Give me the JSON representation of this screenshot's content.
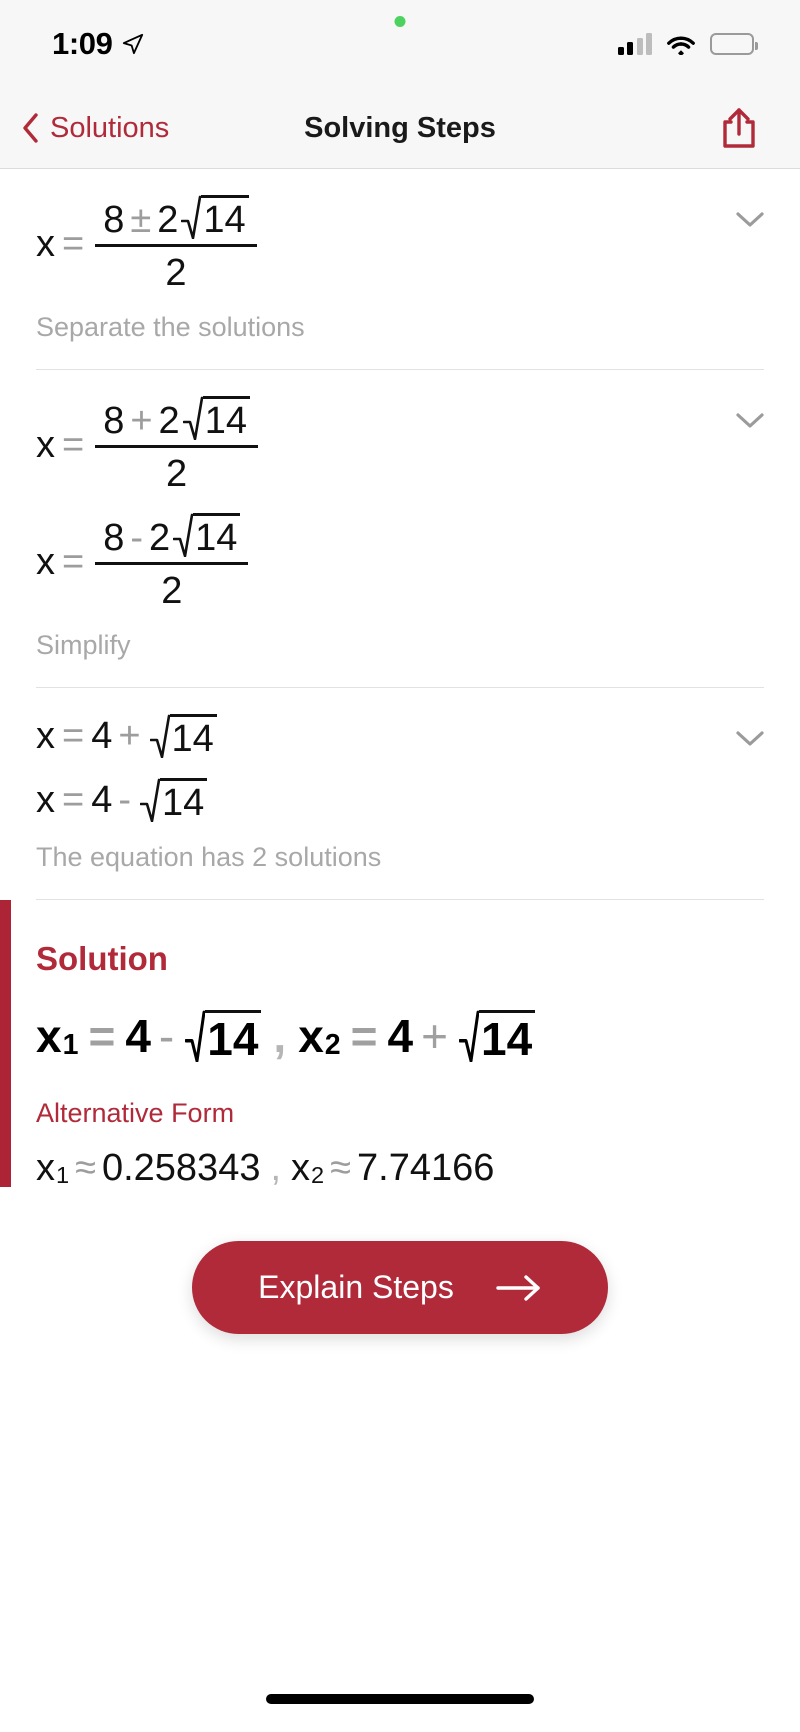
{
  "statusbar": {
    "time": "1:09",
    "location_icon": "location-arrow-icon",
    "signal_icon": "cellular-signal-icon",
    "wifi_icon": "wifi-icon",
    "battery_icon": "battery-icon",
    "recording_dot": "green-status-dot"
  },
  "navbar": {
    "back_label": "Solutions",
    "back_icon": "chevron-left-icon",
    "title": "Solving Steps",
    "share_icon": "share-icon"
  },
  "steps": [
    {
      "caption": "Separate the solutions",
      "chevron_icon": "chevron-down-icon",
      "lines": [
        {
          "lhs": "x",
          "eq": "=",
          "type": "fraction",
          "num": {
            "a": "8",
            "op": "±",
            "coef": "2",
            "radicand": "14"
          },
          "den": "2"
        }
      ]
    },
    {
      "caption": "Simplify",
      "chevron_icon": "chevron-down-icon",
      "lines": [
        {
          "lhs": "x",
          "eq": "=",
          "type": "fraction",
          "num": {
            "a": "8",
            "op": "+",
            "coef": "2",
            "radicand": "14"
          },
          "den": "2"
        },
        {
          "lhs": "x",
          "eq": "=",
          "type": "fraction",
          "num": {
            "a": "8",
            "op": "-",
            "coef": "2",
            "radicand": "14"
          },
          "den": "2"
        }
      ]
    },
    {
      "caption": "The equation has 2 solutions",
      "chevron_icon": "chevron-down-icon",
      "lines": [
        {
          "lhs": "x",
          "eq": "=",
          "type": "simple",
          "a": "4",
          "op": "+",
          "radicand": "14"
        },
        {
          "lhs": "x",
          "eq": "=",
          "type": "simple",
          "a": "4",
          "op": "-",
          "radicand": "14"
        }
      ]
    }
  ],
  "solution": {
    "title": "Solution",
    "accent_color": "#ad2437",
    "primary": {
      "x1_label": "x",
      "x1_sub": "1",
      "x1_eq": "=",
      "x1_a": "4",
      "x1_op": "-",
      "x1_radicand": "14",
      "separator": ",",
      "x2_label": "x",
      "x2_sub": "2",
      "x2_eq": "=",
      "x2_a": "4",
      "x2_op": "+",
      "x2_radicand": "14"
    },
    "alternative_title": "Alternative Form",
    "alternative": {
      "x1_label": "x",
      "x1_sub": "1",
      "approx": "≈",
      "x1_value": "0.258343",
      "separator": ",",
      "x2_label": "x",
      "x2_sub": "2",
      "x2_value": "7.74166"
    }
  },
  "cta": {
    "label": "Explain Steps",
    "arrow_icon": "arrow-right-icon",
    "color": "#b02a3a"
  }
}
